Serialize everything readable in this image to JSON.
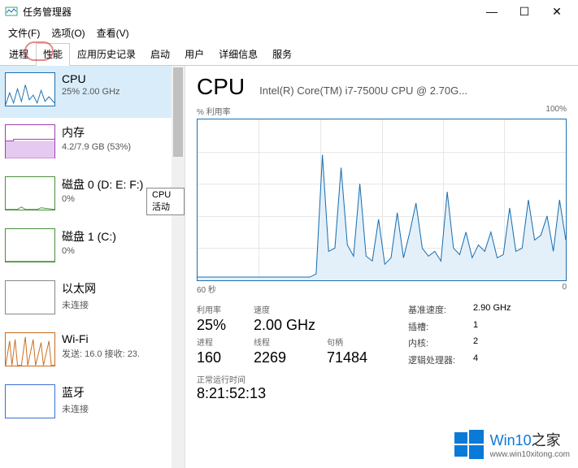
{
  "window": {
    "title": "任务管理器",
    "controls": {
      "min": "—",
      "max": "☐",
      "close": "✕"
    }
  },
  "menu": {
    "file": "文件(F)",
    "options": "选项(O)",
    "view": "查看(V)"
  },
  "tabs": {
    "processes": "进程",
    "performance": "性能",
    "app_history": "应用历史记录",
    "startup": "启动",
    "users": "用户",
    "details": "详细信息",
    "services": "服务"
  },
  "tooltip": "CPU 活动",
  "sidebar": {
    "items": [
      {
        "title": "CPU",
        "sub": "25% 2.00 GHz"
      },
      {
        "title": "内存",
        "sub": "4.2/7.9 GB (53%)"
      },
      {
        "title": "磁盘 0 (D: E: F:)",
        "sub": "0%"
      },
      {
        "title": "磁盘 1 (C:)",
        "sub": "0%"
      },
      {
        "title": "以太网",
        "sub": "未连接"
      },
      {
        "title": "Wi-Fi",
        "sub": "发送: 16.0 接收: 23."
      },
      {
        "title": "蓝牙",
        "sub": "未连接"
      }
    ]
  },
  "main": {
    "title": "CPU",
    "subtitle": "Intel(R) Core(TM) i7-7500U CPU @ 2.70G...",
    "chart_top_left": "% 利用率",
    "chart_top_right": "100%",
    "chart_bottom_left": "60 秒",
    "chart_bottom_right": "0"
  },
  "chart_data": {
    "type": "line",
    "title": "% 利用率",
    "xlabel": "60 秒 → 0",
    "ylabel": "利用率",
    "ylim": [
      0,
      100
    ],
    "xrange_seconds": [
      60,
      0
    ],
    "series": [
      {
        "name": "CPU 利用率",
        "values": [
          2,
          2,
          2,
          2,
          2,
          2,
          2,
          2,
          2,
          2,
          2,
          2,
          2,
          2,
          2,
          2,
          2,
          2,
          2,
          4,
          78,
          18,
          20,
          70,
          22,
          15,
          60,
          15,
          12,
          38,
          10,
          14,
          42,
          14,
          30,
          48,
          20,
          15,
          18,
          12,
          55,
          20,
          16,
          30,
          14,
          22,
          18,
          30,
          14,
          16,
          45,
          18,
          20,
          50,
          25,
          28,
          40,
          18,
          50,
          25
        ]
      }
    ]
  },
  "stats": {
    "labels": {
      "util": "利用率",
      "speed": "速度",
      "handles": "句柄",
      "procs": "进程",
      "threads": "线程"
    },
    "util": "25%",
    "speed": "2.00 GHz",
    "procs": "160",
    "threads": "2269",
    "handles": "71484",
    "right": {
      "base_speed_l": "基准速度:",
      "base_speed_v": "2.90 GHz",
      "sockets_l": "插槽:",
      "sockets_v": "1",
      "cores_l": "内核:",
      "cores_v": "2",
      "logical_l": "逻辑处理器:",
      "logical_v": "4"
    },
    "uptime_l": "正常运行时间",
    "uptime_v": "8:21:52:13"
  },
  "watermark": {
    "title_a": "Win10",
    "title_b": "之家",
    "url": "www.win10xitong.com"
  }
}
